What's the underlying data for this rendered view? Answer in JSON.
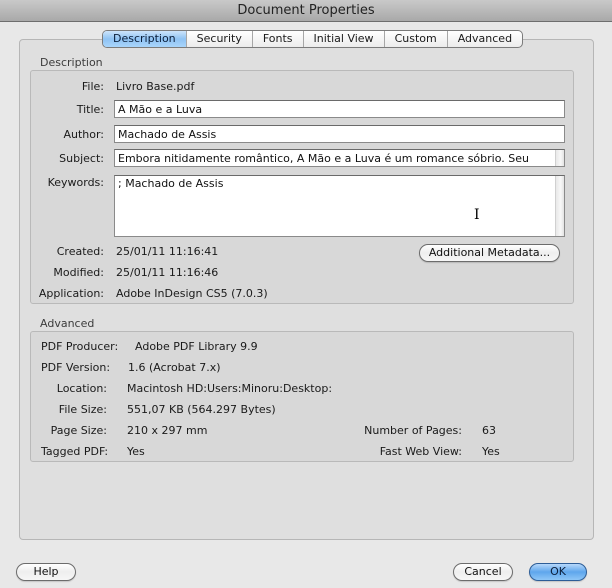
{
  "window": {
    "title": "Document Properties"
  },
  "tabs": [
    {
      "label": "Description",
      "active": true
    },
    {
      "label": "Security",
      "active": false
    },
    {
      "label": "Fonts",
      "active": false
    },
    {
      "label": "Initial View",
      "active": false
    },
    {
      "label": "Custom",
      "active": false
    },
    {
      "label": "Advanced",
      "active": false
    }
  ],
  "description": {
    "group_label": "Description",
    "file": {
      "label": "File:",
      "value": "Livro Base.pdf"
    },
    "title": {
      "label": "Title:",
      "value": "A Mão e a Luva"
    },
    "author": {
      "label": "Author:",
      "value": "Machado de Assis"
    },
    "subject": {
      "label": "Subject:",
      "value": "Embora nitidamente romântico, A Mão e a Luva é um romance sóbrio. Seu"
    },
    "keywords": {
      "label": "Keywords:",
      "value": "; Machado de Assis"
    },
    "created": {
      "label": "Created:",
      "value": "25/01/11 11:16:41"
    },
    "modified": {
      "label": "Modified:",
      "value": "25/01/11 11:16:46"
    },
    "application": {
      "label": "Application:",
      "value": "Adobe InDesign CS5 (7.0.3)"
    },
    "additional_metadata_button": "Additional Metadata..."
  },
  "advanced": {
    "group_label": "Advanced",
    "pdf_producer": {
      "label": "PDF Producer:",
      "value": "Adobe PDF Library 9.9"
    },
    "pdf_version": {
      "label": "PDF Version:",
      "value": "1.6 (Acrobat 7.x)"
    },
    "location": {
      "label": "Location:",
      "value": "Macintosh HD:Users:Minoru:Desktop:"
    },
    "file_size": {
      "label": "File Size:",
      "value": "551,07 KB (564.297 Bytes)"
    },
    "page_size": {
      "label": "Page Size:",
      "value": "210 x 297 mm"
    },
    "tagged_pdf": {
      "label": "Tagged PDF:",
      "value": "Yes"
    },
    "number_of_pages": {
      "label": "Number of Pages:",
      "value": "63"
    },
    "fast_web_view": {
      "label": "Fast Web View:",
      "value": "Yes"
    }
  },
  "footer": {
    "help_label": "Help",
    "cancel_label": "Cancel",
    "ok_label": "OK"
  },
  "colors": {
    "accent": "#5ea6ec",
    "tab_active": "#8fc3f3"
  }
}
